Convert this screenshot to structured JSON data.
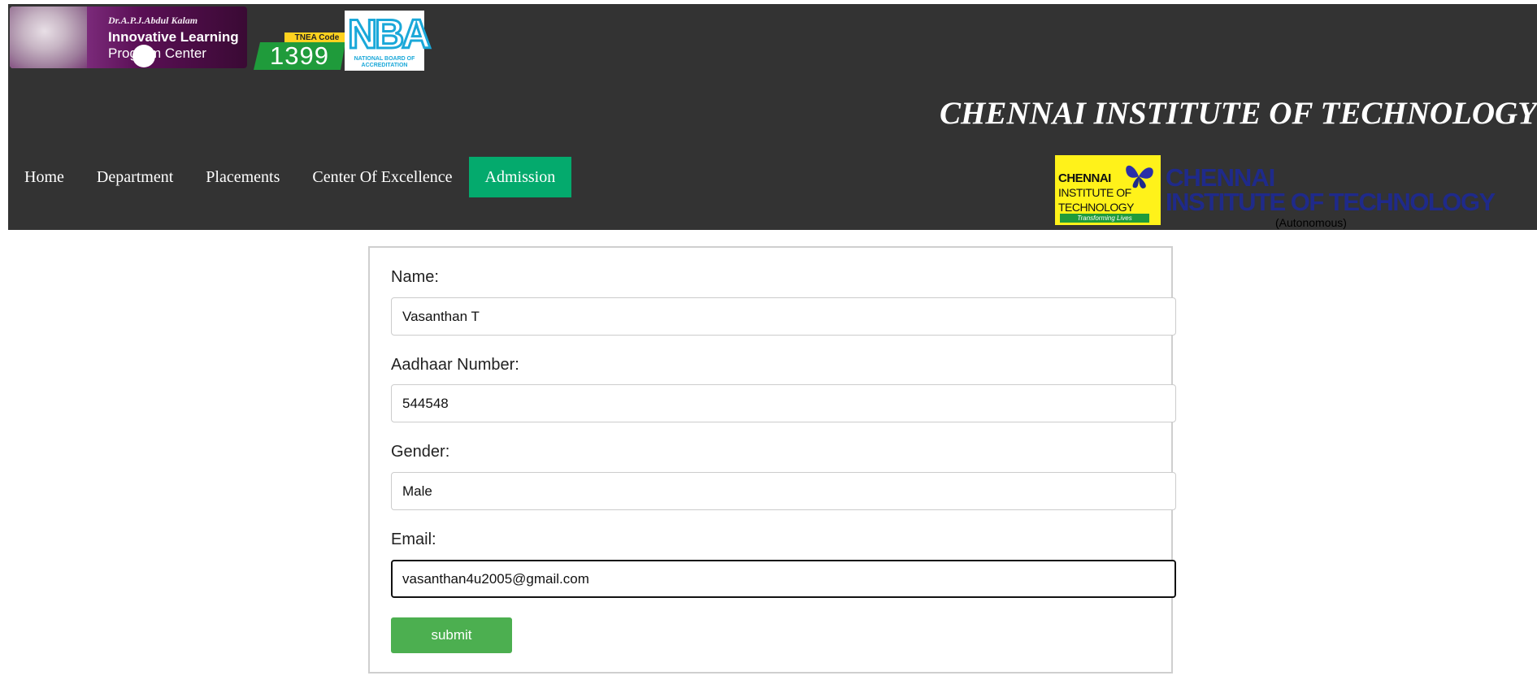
{
  "header": {
    "ilpc_logo": {
      "small": "Dr.A.P.J.Abdul Kalam",
      "line1": "Innovative Learning",
      "line2": "Program Center"
    },
    "tnea": {
      "label": "TNEA Code",
      "code": "1399"
    },
    "nba": {
      "letters": "NBA",
      "sub": "NATIONAL BOARD OF ACCREDITATION"
    },
    "title": "CHENNAI INSTITUTE OF TECHNOLOGY",
    "nav": [
      "Home",
      "Department",
      "Placements",
      "Center Of Excellence",
      "Admission"
    ],
    "active_nav": "Admission",
    "cit_logo": {
      "l1": "CHENNAI",
      "l2": "INSTITUTE OF",
      "l3": "TECHNOLOGY",
      "tagline": "Transforming Lives",
      "text1": "CHENNAI",
      "text2": "INSTITUTE OF TECHNOLOGY",
      "autonomous": "(Autonomous)"
    }
  },
  "form": {
    "fields": [
      {
        "label": "Name:",
        "value": "Vasanthan T"
      },
      {
        "label": "Aadhaar Number:",
        "value": "544548"
      },
      {
        "label": "Gender:",
        "value": "Male"
      },
      {
        "label": "Email:",
        "value": "vasanthan4u2005@gmail.com"
      }
    ],
    "submit_label": "submit"
  },
  "colors": {
    "header_bg": "#333333",
    "active_nav": "#04aa6d",
    "submit": "#4caf50"
  }
}
